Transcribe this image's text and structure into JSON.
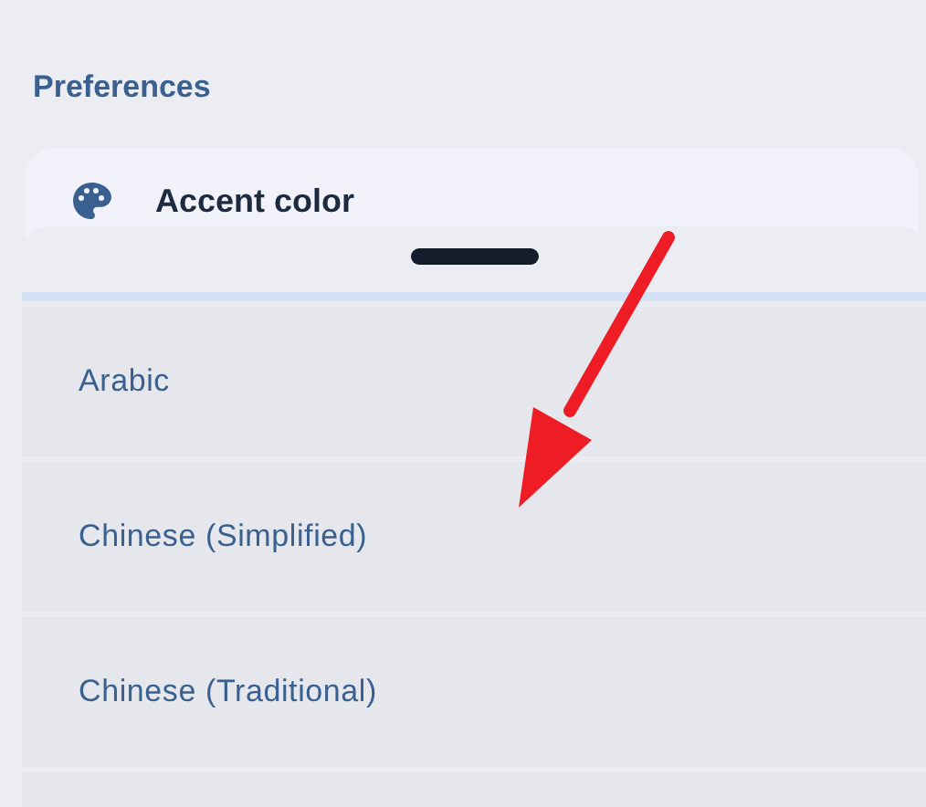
{
  "section_title": "Preferences",
  "preference_card": {
    "label": "Accent color"
  },
  "language_sheet": {
    "options": [
      {
        "label": "Arabic"
      },
      {
        "label": "Chinese (Simplified)"
      },
      {
        "label": "Chinese (Traditional)"
      }
    ]
  },
  "annotation": {
    "kind": "arrow",
    "color": "#ee1c24"
  }
}
